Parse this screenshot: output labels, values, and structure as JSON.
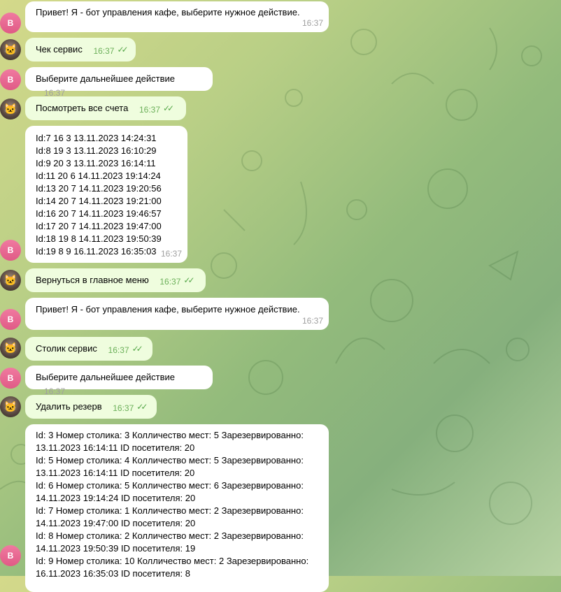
{
  "bot_avatar_letter": "B",
  "messages": [
    {
      "from": "bot",
      "text": "Привет! Я - бот управления кафе, выберите нужное действие.",
      "time": "16:37"
    },
    {
      "from": "user",
      "text": "Чек сервис",
      "time": "16:37"
    },
    {
      "from": "bot",
      "text": "Выберите дальнейшее действие",
      "time": "16:37"
    },
    {
      "from": "user",
      "text": "Посмотреть все счета",
      "time": "16:37"
    },
    {
      "from": "bot",
      "lines": [
        "Id:7 16 3 13.11.2023 14:24:31",
        "Id:8 19 3 13.11.2023 16:10:29",
        "Id:9 20 3 13.11.2023 16:14:11",
        "Id:11 20 6 14.11.2023 19:14:24",
        "Id:13 20 7 14.11.2023 19:20:56",
        "Id:14 20 7 14.11.2023 19:21:00",
        "Id:16 20 7 14.11.2023 19:46:57",
        "Id:17 20 7 14.11.2023 19:47:00",
        "Id:18 19 8 14.11.2023 19:50:39",
        "Id:19 8 9 16.11.2023 16:35:03"
      ],
      "time": "16:37"
    },
    {
      "from": "user",
      "text": "Вернуться в главное меню",
      "time": "16:37"
    },
    {
      "from": "bot",
      "text": "Привет! Я - бот управления кафе, выберите нужное действие.",
      "time": "16:37"
    },
    {
      "from": "user",
      "text": "Столик сервис",
      "time": "16:37"
    },
    {
      "from": "bot",
      "text": "Выберите дальнейшее действие",
      "time": "16:37"
    },
    {
      "from": "user",
      "text": "Удалить резерв",
      "time": "16:37"
    },
    {
      "from": "bot",
      "lines": [
        "Id: 3 Номер столика: 3 Колличество мест: 5 Зарезервированно:",
        "13.11.2023 16:14:11 ID посетителя: 20",
        "Id: 5 Номер столика: 4 Колличество мест: 5 Зарезервированно:",
        "13.11.2023 16:14:11 ID посетителя: 20",
        "Id: 6 Номер столика: 5 Колличество мест: 6 Зарезервированно:",
        "14.11.2023 19:14:24 ID посетителя: 20",
        "Id: 7 Номер столика: 1 Колличество мест: 2 Зарезервированно:",
        "14.11.2023 19:47:00 ID посетителя: 20",
        "Id: 8 Номер столика: 2 Колличество мест: 2 Зарезервированно:",
        "14.11.2023 19:50:39 ID посетителя: 19",
        "Id: 9 Номер столика: 10 Колличество мест: 2 Зарезервированно:",
        "16.11.2023 16:35:03 ID посетителя: 8"
      ],
      "time": ""
    }
  ]
}
